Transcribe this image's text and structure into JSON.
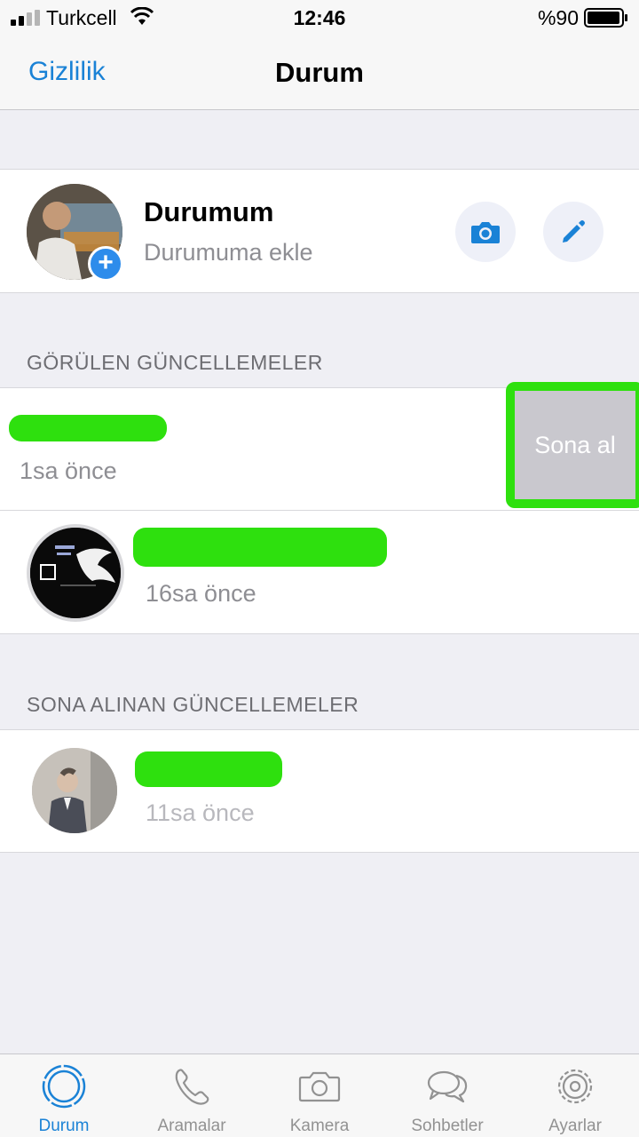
{
  "status_bar": {
    "carrier": "Turkcell",
    "time": "12:46",
    "battery_percent": "%90"
  },
  "nav": {
    "back_label": "Gizlilik",
    "title": "Durum"
  },
  "my_status": {
    "name": "Durumum",
    "subtitle": "Durumuma ekle",
    "add_badge": "+",
    "camera_icon": "camera-icon",
    "edit_icon": "pencil-icon"
  },
  "sections": {
    "viewed_header": "GÖRÜLEN GÜNCELLEMELER",
    "muted_header": "SONA ALINAN GÜNCELLEMELER"
  },
  "viewed_updates": [
    {
      "time": "1sa önce",
      "swipe_action": "Sona al"
    },
    {
      "time": "16sa önce"
    }
  ],
  "muted_updates": [
    {
      "time": "11sa önce"
    }
  ],
  "tabs": [
    {
      "label": "Durum",
      "icon": "status-ring-icon",
      "active": true
    },
    {
      "label": "Aramalar",
      "icon": "phone-icon",
      "active": false
    },
    {
      "label": "Kamera",
      "icon": "camera-icon",
      "active": false
    },
    {
      "label": "Sohbetler",
      "icon": "chat-bubbles-icon",
      "active": false
    },
    {
      "label": "Ayarlar",
      "icon": "gear-icon",
      "active": false
    }
  ],
  "colors": {
    "accent": "#1a82d6",
    "redaction": "#2ee00e",
    "inactive_tab": "#929292"
  }
}
